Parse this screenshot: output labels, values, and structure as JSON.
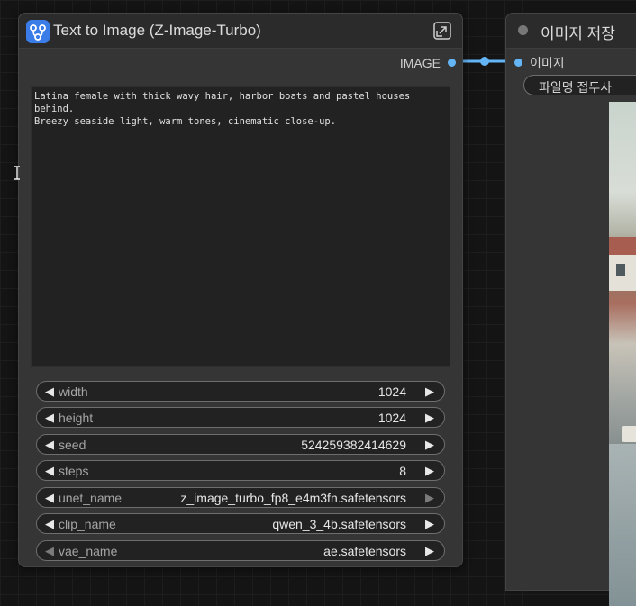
{
  "node": {
    "title": "Text to Image (Z-Image-Turbo)",
    "output_label": "IMAGE",
    "prompt": "Latina female with thick wavy hair, harbor boats and pastel houses behind.\nBreezy seaside light, warm tones, cinematic close-up.",
    "widgets": [
      {
        "label": "width",
        "value": "1024"
      },
      {
        "label": "height",
        "value": "1024"
      },
      {
        "label": "seed",
        "value": "524259382414629"
      },
      {
        "label": "steps",
        "value": "8"
      },
      {
        "label": "unet_name",
        "value": "z_image_turbo_fp8_e4m3fn.safetensors"
      },
      {
        "label": "clip_name",
        "value": "qwen_3_4b.safetensors"
      },
      {
        "label": "vae_name",
        "value": "ae.safetensors"
      }
    ]
  },
  "save_node": {
    "title": "이미지 저장",
    "input_label": "이미지",
    "filename_prefix_label": "파일명 접두사"
  },
  "colors": {
    "accent": "#3b7de8",
    "link": "#64b5f6",
    "node_bg": "#353535",
    "canvas_bg": "#141414"
  },
  "icons": {
    "node_icon": "workflow-icon",
    "expand": "expand-icon",
    "cursor": "text-cursor-icon"
  }
}
